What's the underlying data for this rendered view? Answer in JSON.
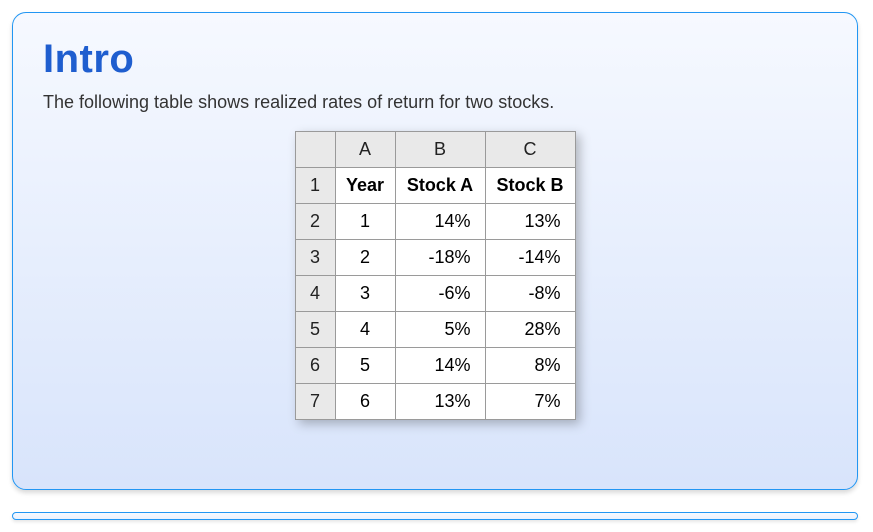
{
  "card": {
    "title": "Intro",
    "description": "The following table shows realized rates of return for two stocks."
  },
  "sheet": {
    "colLetters": [
      "A",
      "B",
      "C"
    ],
    "headerRow": {
      "rownum": "1",
      "cells": [
        "Year",
        "Stock A",
        "Stock B"
      ]
    },
    "rows": [
      {
        "rownum": "2",
        "cells": [
          "1",
          "14%",
          "13%"
        ]
      },
      {
        "rownum": "3",
        "cells": [
          "2",
          "-18%",
          "-14%"
        ]
      },
      {
        "rownum": "4",
        "cells": [
          "3",
          "-6%",
          "-8%"
        ]
      },
      {
        "rownum": "5",
        "cells": [
          "4",
          "5%",
          "28%"
        ]
      },
      {
        "rownum": "6",
        "cells": [
          "5",
          "14%",
          "8%"
        ]
      },
      {
        "rownum": "7",
        "cells": [
          "6",
          "13%",
          "7%"
        ]
      }
    ]
  }
}
